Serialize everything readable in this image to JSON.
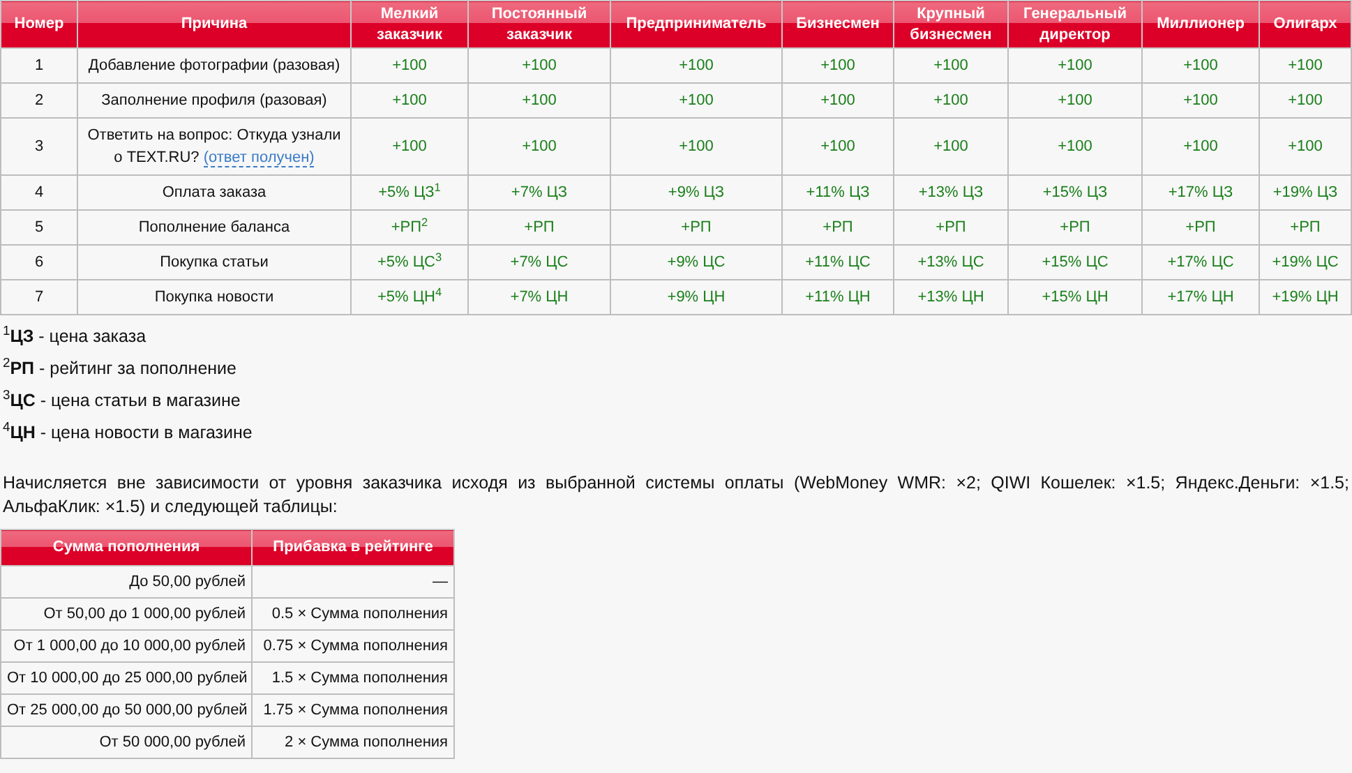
{
  "levels_table": {
    "columns": [
      "Номер",
      "Причина",
      "Мелкий заказчик",
      "Постоянный заказчик",
      "Предприниматель",
      "Бизнесмен",
      "Крупный бизнесмен",
      "Генеральный директор",
      "Миллионер",
      "Олигарх"
    ],
    "rows": [
      {
        "number": "1",
        "reason": "Добавление фотографии (разовая)",
        "values": [
          "+100",
          "+100",
          "+100",
          "+100",
          "+100",
          "+100",
          "+100",
          "+100"
        ]
      },
      {
        "number": "2",
        "reason": "Заполнение профиля (разовая)",
        "values": [
          "+100",
          "+100",
          "+100",
          "+100",
          "+100",
          "+100",
          "+100",
          "+100"
        ]
      },
      {
        "number": "3",
        "reason": "Ответить на вопрос: Откуда узнали о TEXT.RU?",
        "link": "(ответ получен)",
        "values": [
          "+100",
          "+100",
          "+100",
          "+100",
          "+100",
          "+100",
          "+100",
          "+100"
        ]
      },
      {
        "number": "4",
        "reason": "Оплата заказа",
        "values": [
          "+5% ЦЗ$^{1}$",
          "+7% ЦЗ",
          "+9% ЦЗ",
          "+11% ЦЗ",
          "+13% ЦЗ",
          "+15% ЦЗ",
          "+17% ЦЗ",
          "+19% ЦЗ"
        ]
      },
      {
        "number": "5",
        "reason": "Пополнение баланса",
        "values": [
          "+РП$^{2}$",
          "+РП",
          "+РП",
          "+РП",
          "+РП",
          "+РП",
          "+РП",
          "+РП"
        ]
      },
      {
        "number": "6",
        "reason": "Покупка статьи",
        "values": [
          "+5% ЦС$^{3}$",
          "+7% ЦС",
          "+9% ЦС",
          "+11% ЦС",
          "+13% ЦС",
          "+15% ЦС",
          "+17% ЦС",
          "+19% ЦС"
        ]
      },
      {
        "number": "7",
        "reason": "Покупка новости",
        "values": [
          "+5% ЦН$^{4}$",
          "+7% ЦН",
          "+9% ЦН",
          "+11% ЦН",
          "+13% ЦН",
          "+15% ЦН",
          "+17% ЦН",
          "+19% ЦН"
        ]
      }
    ]
  },
  "footnotes": [
    "$^{1}$**ЦЗ** - цена заказа",
    "$^{2}$**РП** - рейтинг за пополнение",
    "$^{3}$**ЦС** - цена статьи в магазине",
    "$^{4}$**ЦН** - цена новости в магазине"
  ],
  "description": "Начисляется вне зависимости от уровня заказчика исходя из выбранной системы оплаты (WebMoney WMR: ×2; QIWI Кошелек: ×1.5; Яндекс.Деньги: ×1.5; АльфаКлик: ×1.5) и следующей таблицы:",
  "topup_table": {
    "columns": [
      "Сумма пополнения",
      "Прибавка в рейтинге"
    ],
    "rows": [
      {
        "amount": "До 50,00 рублей",
        "bonus": "—"
      },
      {
        "amount": "От 50,00 до 1 000,00 рублей",
        "bonus": "0.5 × Сумма пополнения"
      },
      {
        "amount": "От 1 000,00 до 10 000,00 рублей",
        "bonus": "0.75 × Сумма пополнения"
      },
      {
        "amount": "От 10 000,00 до 25 000,00 рублей",
        "bonus": "1.5 × Сумма пополнения"
      },
      {
        "amount": "От 25 000,00 до 50 000,00 рублей",
        "bonus": "1.75 × Сумма пополнения"
      },
      {
        "amount": "От 50 000,00 рублей",
        "bonus": "2 × Сумма пополнения"
      }
    ]
  }
}
